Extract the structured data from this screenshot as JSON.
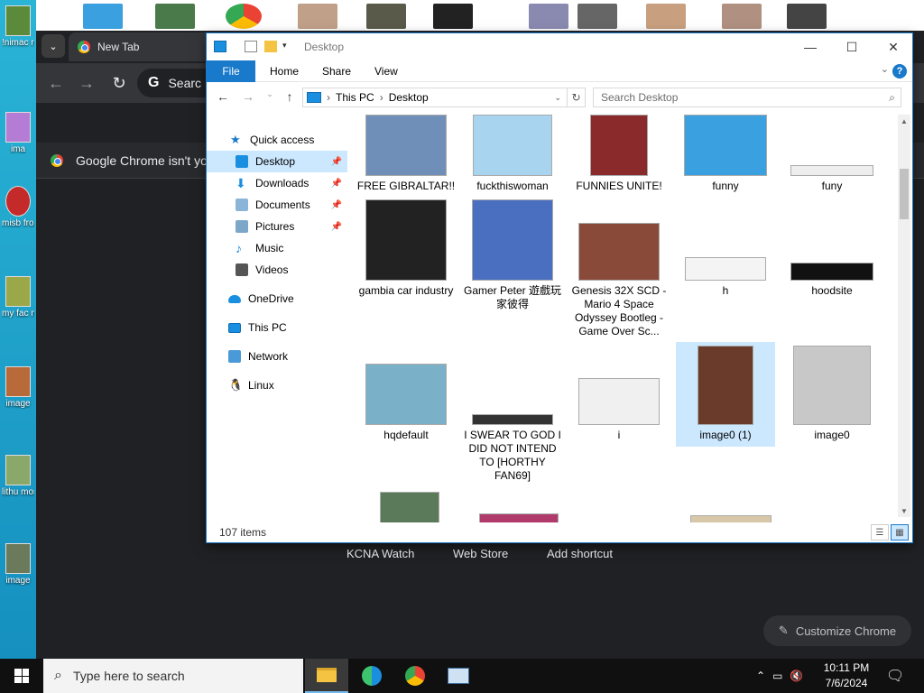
{
  "desktop": {
    "left_icons": [
      {
        "label": "!nimac rary m"
      },
      {
        "label": "ima"
      },
      {
        "label": "misb fron"
      },
      {
        "label": "my fac n-arab"
      },
      {
        "label": "image"
      },
      {
        "label": "lithu mom"
      },
      {
        "label": "image"
      }
    ]
  },
  "chrome": {
    "tab_title": "New Tab",
    "omnibox_text": "Searc",
    "infobar_text": "Google Chrome isn't you",
    "shortcuts": [
      "KCNA Watch",
      "Web Store",
      "Add shortcut"
    ],
    "customize_label": "Customize Chrome"
  },
  "explorer": {
    "title": "Desktop",
    "ribbon_tabs": {
      "file": "File",
      "home": "Home",
      "share": "Share",
      "view": "View"
    },
    "breadcrumb": [
      "This PC",
      "Desktop"
    ],
    "search_placeholder": "Search Desktop",
    "nav_items": [
      {
        "label": "Quick access",
        "icon": "star-icon",
        "color": "#1979ca"
      },
      {
        "label": "Desktop",
        "icon": "desktop-folder-icon",
        "color": "#1a8fe0",
        "pinned": true,
        "selected": true
      },
      {
        "label": "Downloads",
        "icon": "download-icon",
        "color": "#1a8fe0",
        "pinned": true
      },
      {
        "label": "Documents",
        "icon": "documents-icon",
        "color": "#8ab4d8",
        "pinned": true
      },
      {
        "label": "Pictures",
        "icon": "pictures-icon",
        "color": "#7da7c9",
        "pinned": true
      },
      {
        "label": "Music",
        "icon": "music-icon",
        "color": "#1a8fe0"
      },
      {
        "label": "Videos",
        "icon": "videos-icon",
        "color": "#555555"
      },
      {
        "label": "OneDrive",
        "icon": "onedrive-icon",
        "color": "#1a8fe0"
      },
      {
        "label": "This PC",
        "icon": "pc-icon",
        "color": "#1a8fe0"
      },
      {
        "label": "Network",
        "icon": "network-icon",
        "color": "#1a8fe0"
      },
      {
        "label": "Linux",
        "icon": "linux-icon",
        "color": "#333333"
      }
    ],
    "files": [
      {
        "name": "FREE GIBRALTAR!!",
        "thumb_color": "#6f8fb8"
      },
      {
        "name": "fuckthiswoman",
        "thumb_color": "#a9d4ef"
      },
      {
        "name": "FUNNIES UNITE!",
        "thumb_color": "#8a2a2a"
      },
      {
        "name": "funny",
        "thumb_color": "#3aa0e0"
      },
      {
        "name": "funy",
        "thumb_color": "#eeeeee"
      },
      {
        "name": "gambia car industry",
        "thumb_color": "#222222"
      },
      {
        "name": "Gamer Peter 遊戲玩家彼得",
        "thumb_color": "#4a6fc0"
      },
      {
        "name": "Genesis 32X SCD - Mario 4 Space Odyssey Bootleg - Game Over Sc...",
        "thumb_color": "#8a4a3a"
      },
      {
        "name": "h",
        "thumb_color": "#f4f4f4"
      },
      {
        "name": "hoodsite",
        "thumb_color": "#111111"
      },
      {
        "name": "hqdefault",
        "thumb_color": "#7ab0c8"
      },
      {
        "name": "I SWEAR TO GOD I DID NOT INTEND TO [HORTHY FAN69]",
        "thumb_color": "#333333"
      },
      {
        "name": "i",
        "thumb_color": "#f0f0f0"
      },
      {
        "name": "image0 (1)",
        "thumb_color": "#6a3a2a"
      },
      {
        "name": "image0",
        "thumb_color": "#c8c8c8"
      }
    ],
    "status": "107 items"
  },
  "taskbar": {
    "search_placeholder": "Type here to search",
    "time": "10:11 PM",
    "date": "7/6/2024"
  }
}
